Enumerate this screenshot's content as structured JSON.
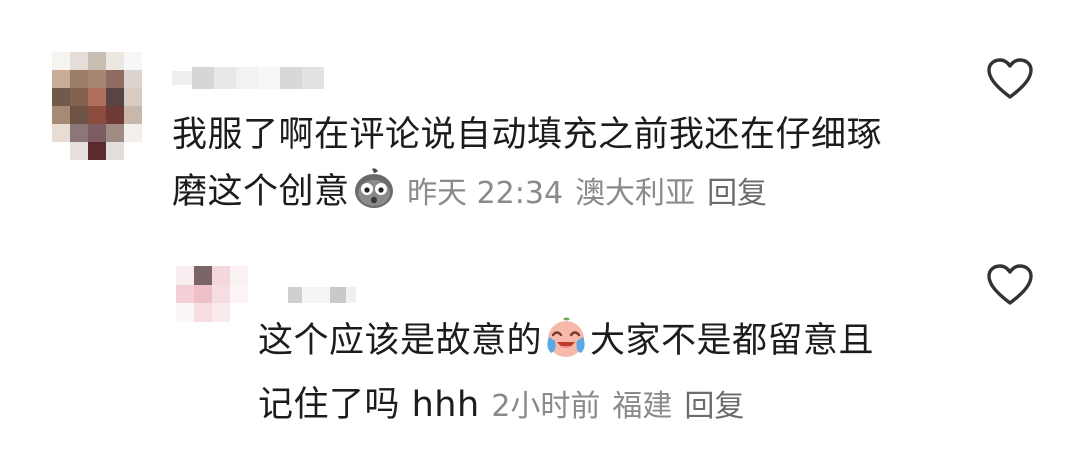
{
  "comments": [
    {
      "text_lines": [
        "我服了啊在评论说自动填充之前我还在仔细琢",
        "磨这个创意"
      ],
      "emoji": "surprised-face-emoji",
      "time": "昨天 22:34",
      "location": "澳大利亚",
      "reply_label": "回复",
      "like_icon": "heart-outline-icon"
    },
    {
      "text_lines": [
        "这个应该是故意的",
        "大家不是都留意且",
        "记住了吗 hhh"
      ],
      "emoji": "crying-laughing-face-emoji",
      "time": "2小时前",
      "location": "福建",
      "reply_label": "回复",
      "like_icon": "heart-outline-icon"
    }
  ],
  "colors": {
    "text": "#1c1c1c",
    "meta": "#8a8a8a",
    "reply": "#6c6c6c",
    "icon": "#333333"
  }
}
